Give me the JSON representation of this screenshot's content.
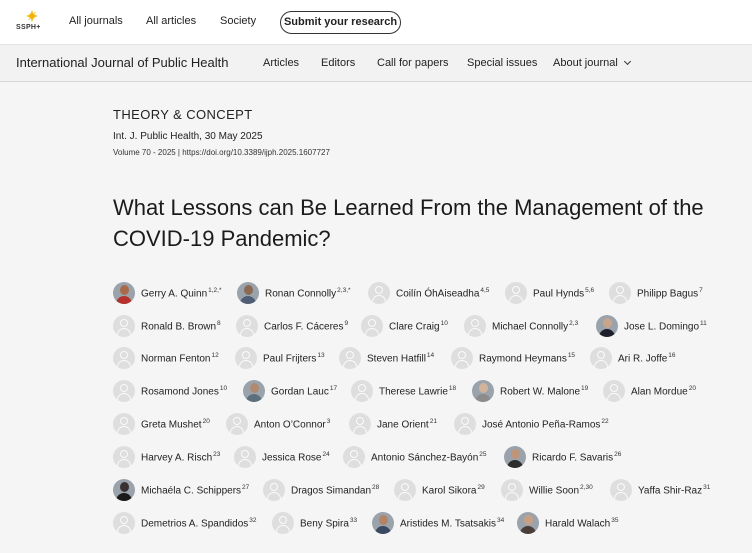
{
  "topbar": {
    "logo_text": "SSPH+",
    "nav": [
      "All journals",
      "All articles",
      "Society"
    ],
    "submit_label": "Submit your research"
  },
  "journalbar": {
    "title": "International Journal of Public Health",
    "nav": [
      "Articles",
      "Editors",
      "Call for papers",
      "Special issues",
      "About journal"
    ]
  },
  "article": {
    "type": "THEORY & CONCEPT",
    "citation": "Int. J. Public Health, 30 May 2025",
    "volume": "Volume 70 - 2025 | https://doi.org/10.3389/ijph.2025.1607727",
    "title": "What Lessons can Be Learned From the Management of the COVID-19 Pandemic?"
  },
  "authors": [
    {
      "name": "Gerry A. Quinn",
      "aff": "1,2,*",
      "photo": true,
      "skin": "#a86a48",
      "shirt": "#b5332c"
    },
    {
      "name": "Ronan Connolly",
      "aff": "2,3,*",
      "photo": true,
      "skin": "#8a6a55",
      "shirt": "#4f5d75"
    },
    {
      "name": "Coilín ÓhAiseadha",
      "aff": "4,5",
      "photo": false
    },
    {
      "name": "Paul Hynds",
      "aff": "5,6",
      "photo": false
    },
    {
      "name": "Philipp Bagus",
      "aff": "7",
      "photo": false
    },
    {
      "name": "Ronald B. Brown",
      "aff": "8",
      "photo": false
    },
    {
      "name": "Carlos F. Cáceres",
      "aff": "9",
      "photo": false
    },
    {
      "name": "Clare Craig",
      "aff": "10",
      "photo": false
    },
    {
      "name": "Michael Connolly",
      "aff": "2,3",
      "photo": false
    },
    {
      "name": "Jose L. Domingo",
      "aff": "11",
      "photo": true,
      "skin": "#c9a58c",
      "shirt": "#1e1e2a"
    },
    {
      "name": "Norman Fenton",
      "aff": "12",
      "photo": false
    },
    {
      "name": "Paul Frijters",
      "aff": "13",
      "photo": false
    },
    {
      "name": "Steven Hatfill",
      "aff": "14",
      "photo": false
    },
    {
      "name": "Raymond Heymans",
      "aff": "15",
      "photo": false
    },
    {
      "name": "Ari R. Joffe",
      "aff": "16",
      "photo": false
    },
    {
      "name": "Rosamond Jones",
      "aff": "10",
      "photo": false
    },
    {
      "name": "Gordan Lauc",
      "aff": "17",
      "photo": true,
      "skin": "#b08a70",
      "shirt": "#5c6f7d"
    },
    {
      "name": "Therese Lawrie",
      "aff": "18",
      "photo": false
    },
    {
      "name": "Robert W. Malone",
      "aff": "19",
      "photo": true,
      "skin": "#d2b49c",
      "shirt": "#8c8c8c"
    },
    {
      "name": "Alan Mordue",
      "aff": "20",
      "photo": false
    },
    {
      "name": "Greta Mushet",
      "aff": "20",
      "photo": false
    },
    {
      "name": "Anton O’Connor",
      "aff": "3",
      "photo": false
    },
    {
      "name": "Jane Orient",
      "aff": "21",
      "photo": false
    },
    {
      "name": "José Antonio Peña-Ramos",
      "aff": "22",
      "photo": false
    },
    {
      "name": "Harvey A. Risch",
      "aff": "23",
      "photo": false
    },
    {
      "name": "Jessica Rose",
      "aff": "24",
      "photo": false
    },
    {
      "name": "Antonio Sánchez-Bayón",
      "aff": "25",
      "photo": false
    },
    {
      "name": "Ricardo F. Savaris",
      "aff": "26",
      "photo": true,
      "skin": "#c09478",
      "shirt": "#2c2c2c"
    },
    {
      "name": "Michaéla C. Schippers",
      "aff": "27",
      "photo": true,
      "skin": "#3a3232",
      "shirt": "#1a1a1a"
    },
    {
      "name": "Dragos Simandan",
      "aff": "28",
      "photo": false
    },
    {
      "name": "Karol Sikora",
      "aff": "29",
      "photo": false
    },
    {
      "name": "Willie Soon",
      "aff": "2,30",
      "photo": false
    },
    {
      "name": "Yaffa Shir-Raz",
      "aff": "31",
      "photo": false
    },
    {
      "name": "Demetrios A. Spandidos",
      "aff": "32",
      "photo": false
    },
    {
      "name": "Beny Spira",
      "aff": "33",
      "photo": false
    },
    {
      "name": "Aristides M. Tsatsakis",
      "aff": "34",
      "photo": true,
      "skin": "#b38566",
      "shirt": "#3b4a63"
    },
    {
      "name": "Harald Walach",
      "aff": "35",
      "photo": true,
      "skin": "#c79f82",
      "shirt": "#4a3f38"
    }
  ],
  "colors": {
    "page_bg": "#f5f5f5",
    "topbar_bg": "#ffffff",
    "journalbar_bg": "#f2f2f2",
    "logo_accent": "#f0b400",
    "placeholder_avatar": "#dedede"
  },
  "icons": {
    "logo": "sspha-logo-icon",
    "placeholder": "user-placeholder-icon",
    "dropdown": "chevron-down-icon"
  }
}
